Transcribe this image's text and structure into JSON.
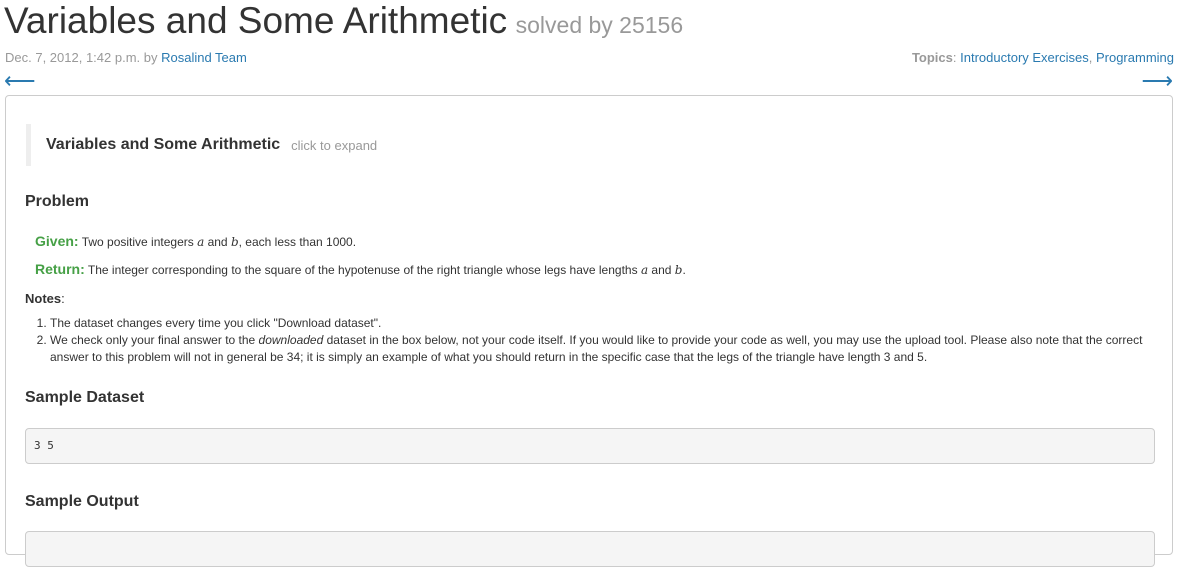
{
  "header": {
    "title": "Variables and Some Arithmetic",
    "solved": "solved by 25156",
    "date": "Dec. 7, 2012, 1:42 p.m. by ",
    "author": "Rosalind Team",
    "topics_label": "Topics",
    "topics_sep": ": ",
    "topic1": "Introductory Exercises",
    "comma": ", ",
    "topic2": "Programming",
    "prev_arrow": "⟵",
    "next_arrow": "⟶"
  },
  "panel": {
    "expand_title": "Variables and Some Arithmetic",
    "expand_hint": "click to expand",
    "problem_heading": "Problem",
    "given_label": "Given:",
    "given_pre": " Two positive integers ",
    "var_a": "a",
    "and": " and ",
    "var_b": "b",
    "given_post": ", each less than 1000.",
    "return_label": "Return:",
    "return_pre": " The integer corresponding to the square of the hypotenuse of the right triangle whose legs have lengths ",
    "return_post": ".",
    "notes_label": "Notes",
    "notes_colon": ":",
    "note1": "The dataset changes every time you click \"Download dataset\".",
    "note2_pre": "We check only your final answer to the ",
    "note2_em": "downloaded",
    "note2_post": " dataset in the box below, not your code itself. If you would like to provide your code as well, you may use the upload tool. Please also note that the correct answer to this problem will not in general be 34; it is simply an example of what you should return in the specific case that the legs of the triangle have length 3 and 5.",
    "sample_dataset_heading": "Sample Dataset",
    "sample_dataset": "3 5",
    "sample_output_heading": "Sample Output"
  }
}
